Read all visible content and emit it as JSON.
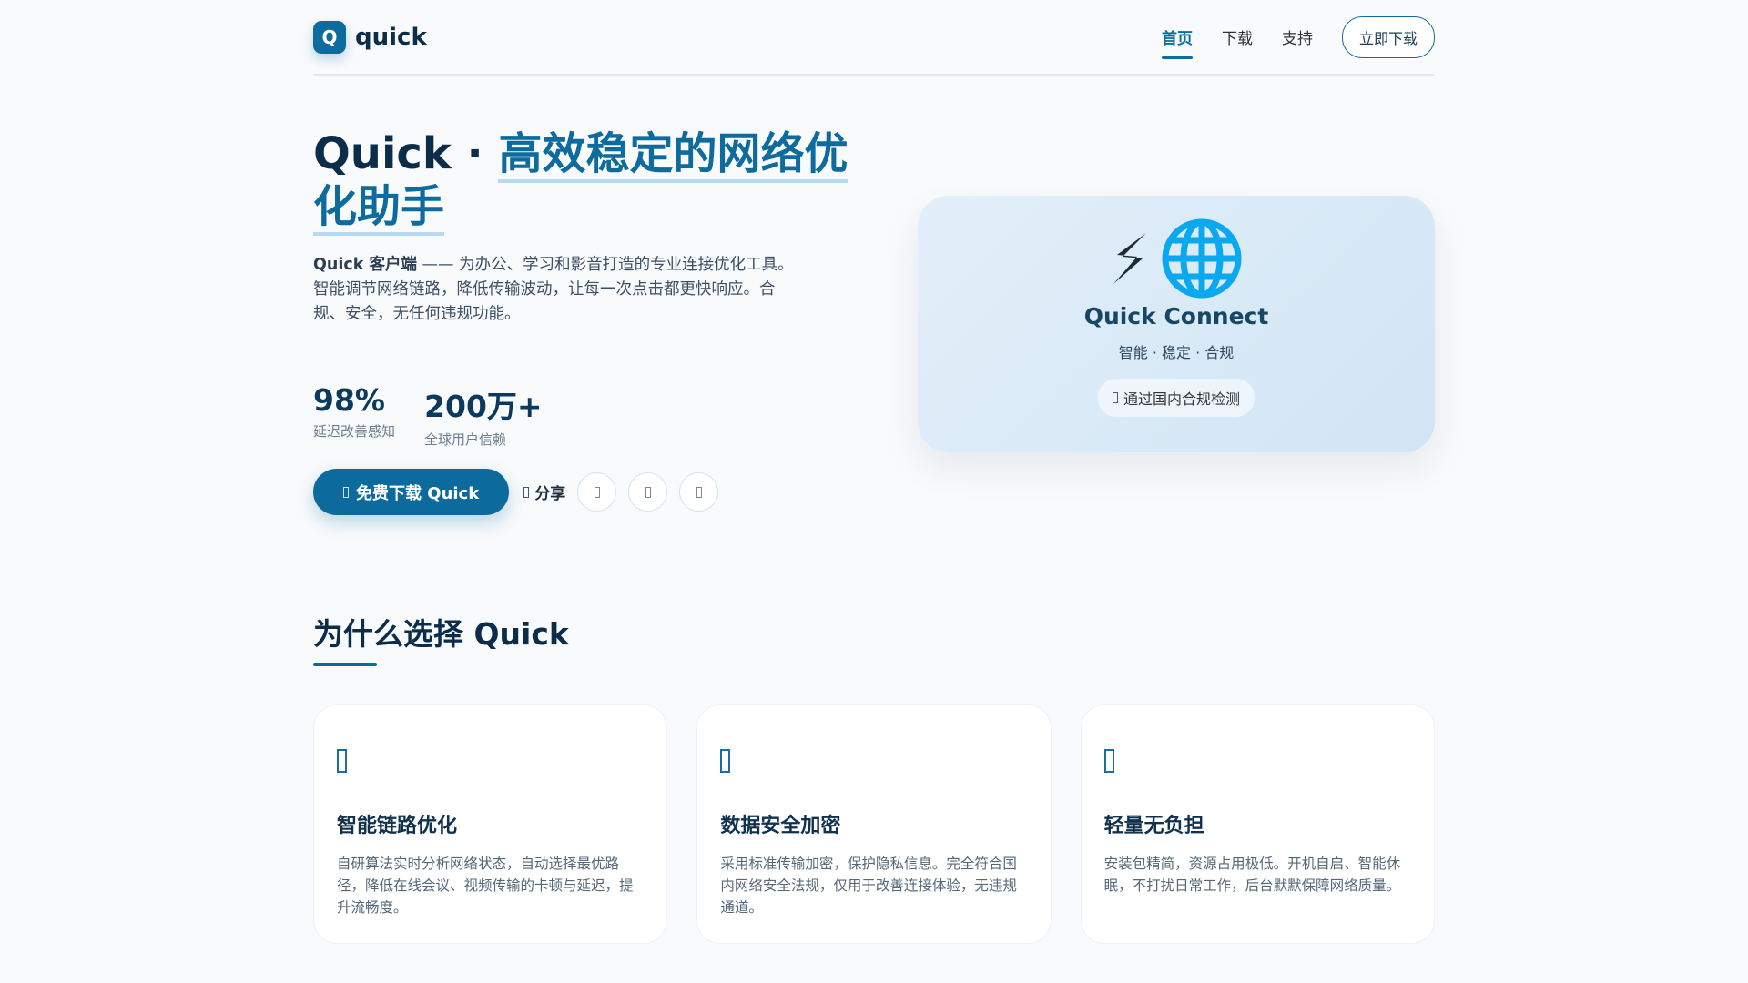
{
  "nav": {
    "logo_letter": "Q",
    "logo_text": "quick",
    "links": [
      "首页",
      "下载",
      "支持"
    ],
    "cta": "立即下载"
  },
  "hero": {
    "title_prefix": "Quick · ",
    "title_highlight": "高效稳定的网络优化助手",
    "desc_bold": "Quick 客户端",
    "desc_line1": " —— 为办公、学习和影音打造的专业连接优化工具。",
    "desc_line2": "智能调节网络链路，降低传输波动，让每一次点击都更快响应。合规、安全，无任何违规功能。",
    "stats": [
      {
        "value": "98%",
        "label": "延迟改善感知"
      },
      {
        "value": "200万+",
        "label": "全球用户信赖"
      }
    ],
    "download_button": "免费下载 Quick",
    "share_label": "分享"
  },
  "hero_card": {
    "emoji": "⚡🌐",
    "title": "Quick Connect",
    "subtitle": "智能 · 稳定 · 合规",
    "badge": "通过国内合规检测"
  },
  "features": {
    "title": "为什么选择 Quick",
    "items": [
      {
        "title": "智能链路优化",
        "desc": "自研算法实时分析网络状态，自动选择最优路径，降低在线会议、视频传输的卡顿与延迟，提升流畅度。"
      },
      {
        "title": "数据安全加密",
        "desc": "采用标准传输加密，保护隐私信息。完全符合国内网络安全法规，仅用于改善连接体验，无违规通道。"
      },
      {
        "title": "轻量无负担",
        "desc": "安装包精简，资源占用极低。开机自启、智能休眠，不打扰日常工作，后台默默保障网络质量。"
      }
    ]
  }
}
